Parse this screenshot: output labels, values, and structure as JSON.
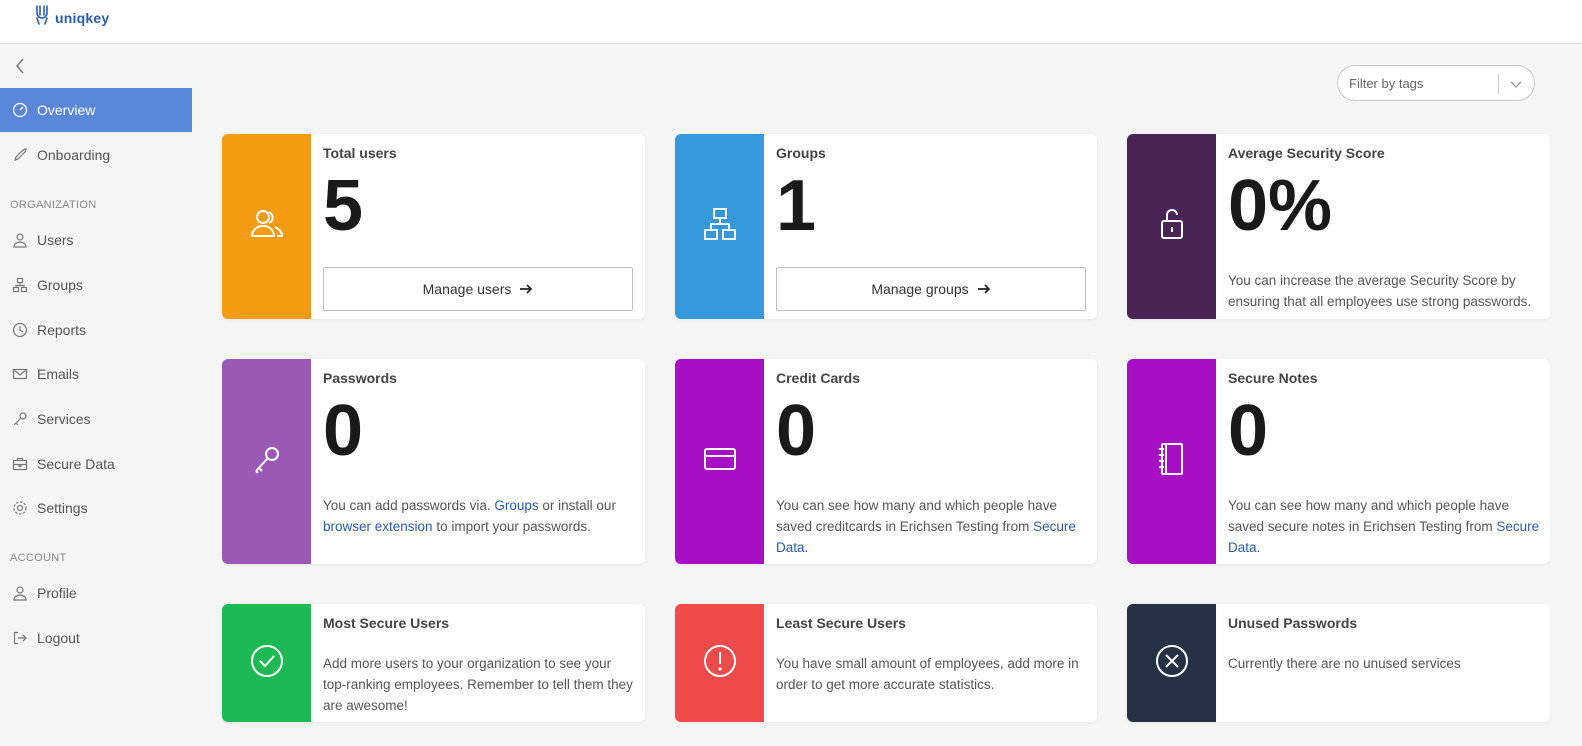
{
  "app": {
    "logo_text": "uniqkey"
  },
  "sidebar": {
    "items_top": [
      {
        "label": "Overview",
        "icon": "gauge-icon"
      },
      {
        "label": "Onboarding",
        "icon": "rocket-icon"
      }
    ],
    "org_section": "ORGANIZATION",
    "org_items": [
      {
        "label": "Users",
        "icon": "user-icon"
      },
      {
        "label": "Groups",
        "icon": "groups-icon"
      },
      {
        "label": "Reports",
        "icon": "clock-icon"
      },
      {
        "label": "Emails",
        "icon": "mail-icon"
      },
      {
        "label": "Services",
        "icon": "key-icon"
      },
      {
        "label": "Secure Data",
        "icon": "briefcase-icon"
      },
      {
        "label": "Settings",
        "icon": "gear-icon"
      }
    ],
    "account_section": "ACCOUNT",
    "account_items": [
      {
        "label": "Profile",
        "icon": "user-icon"
      },
      {
        "label": "Logout",
        "icon": "logout-icon"
      }
    ]
  },
  "filter": {
    "placeholder": "Filter by tags"
  },
  "colors": {
    "orange": "#f39c12",
    "blue": "#3498db",
    "dark_purple": "#4a2454",
    "purple": "#9b59b6",
    "magenta": "#a70fc4",
    "green": "#1db954",
    "red": "#f04b4b",
    "navy": "#253145",
    "active_nav": "#5a87d8",
    "link": "#2a5db0"
  },
  "cards": {
    "total_users": {
      "title": "Total users",
      "value": "5",
      "button": "Manage users"
    },
    "groups": {
      "title": "Groups",
      "value": "1",
      "button": "Manage groups"
    },
    "security": {
      "title": "Average Security Score",
      "value": "0%",
      "desc": "You can increase the average Security Score by ensuring that all employees use strong passwords."
    },
    "passwords": {
      "title": "Passwords",
      "value": "0",
      "desc_pre": "You can add passwords via. ",
      "link1": "Groups",
      "desc_mid": " or install our ",
      "link2": "browser extension",
      "desc_post": " to import your passwords."
    },
    "credit_cards": {
      "title": "Credit Cards",
      "value": "0",
      "desc_pre": "You can see how many and which people have saved creditcards in Erichsen Testing from ",
      "link": "Secure Data",
      "desc_post": "."
    },
    "secure_notes": {
      "title": "Secure Notes",
      "value": "0",
      "desc_pre": "You can see how many and which people have saved secure notes in Erichsen Testing from ",
      "link": "Secure Data",
      "desc_post": "."
    },
    "most_secure": {
      "title": "Most Secure Users",
      "desc": "Add more users to your organization to see your top-ranking employees. Remember to tell them they are awesome!"
    },
    "least_secure": {
      "title": "Least Secure Users",
      "desc": "You have small amount of employees, add more in order to get more accurate statistics."
    },
    "unused": {
      "title": "Unused Passwords",
      "desc": "Currently there are no unused services"
    }
  }
}
